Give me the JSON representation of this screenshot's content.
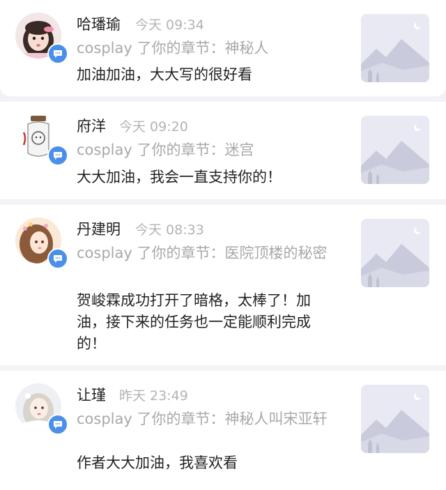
{
  "comments": [
    {
      "avatar": "avatar-girl-pink",
      "name": "哈璠瑜",
      "time": "今天 09:34",
      "action": "cosplay 了你的章节：神秘人",
      "body": "加油加油，大大写的很好看"
    },
    {
      "avatar": "avatar-jar-cartoon",
      "name": "府洋",
      "time": "今天 09:20",
      "action": "cosplay 了你的章节：迷宫",
      "body": "大大加油，我会一直支持你的！"
    },
    {
      "avatar": "avatar-anime-girl",
      "name": "丹建明",
      "time": "今天 08:33",
      "action": "cosplay 了你的章节：医院顶楼的秘密",
      "body": "贺峻霖成功打开了暗格，太棒了！加油，接下来的任务也一定能顺利完成的！"
    },
    {
      "avatar": "avatar-girl-white",
      "name": "让瑾",
      "time": "昨天 23:49",
      "action": "cosplay 了你的章节：神秘人叫宋亚轩",
      "body": "作者大大加油，我喜欢看"
    }
  ],
  "colors": {
    "badge": "#4a90e8",
    "name": "#222222",
    "muted": "#a8a8a8",
    "thumb_bg": "#e8e9f2",
    "mountain": "#c9cbdc"
  },
  "icons": {
    "badge": "chat-bubble-icon",
    "thumb": "image-placeholder-icon"
  }
}
